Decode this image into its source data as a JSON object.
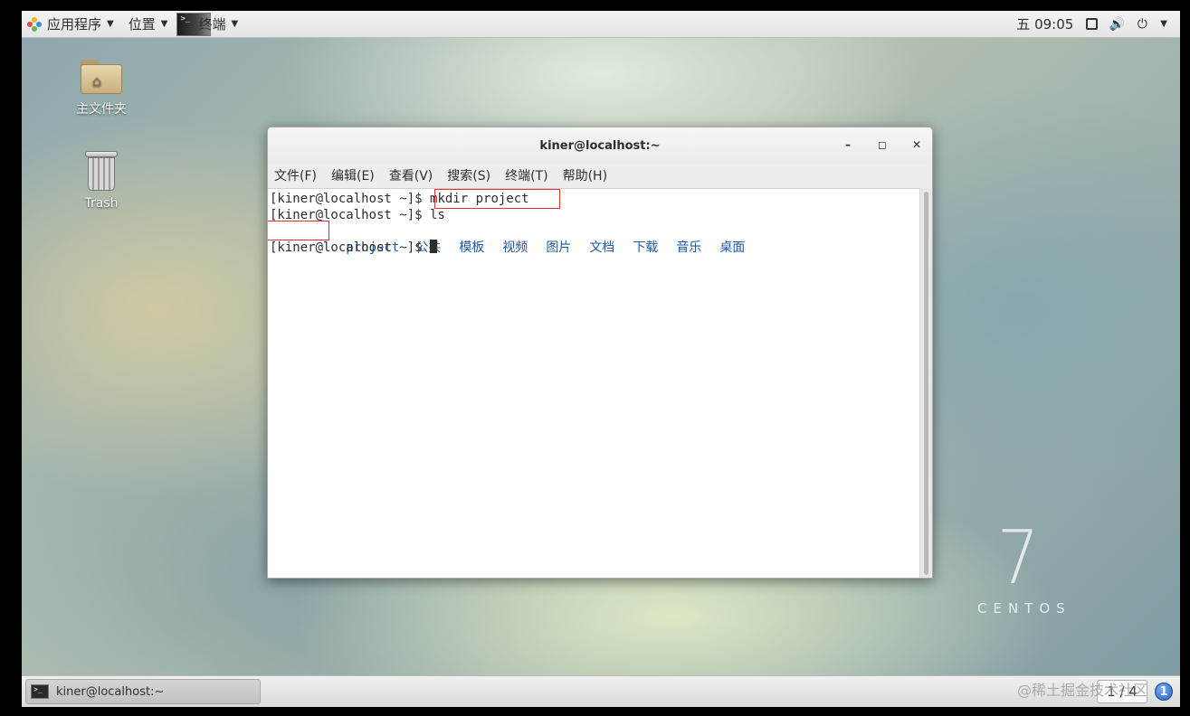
{
  "topbar": {
    "applications_label": "应用程序",
    "places_label": "位置",
    "terminal_label": "终端",
    "clock": "五 09:05"
  },
  "desktop": {
    "icons": [
      {
        "label": "主文件夹",
        "icon": "home-folder-icon"
      },
      {
        "label": "Trash",
        "icon": "trash-icon"
      }
    ],
    "branding": {
      "number": "7",
      "word": "CENTOS"
    }
  },
  "window": {
    "title": "kiner@localhost:~",
    "controls": {
      "minimize": "–",
      "maximize": "◻",
      "close": "✕"
    },
    "menu": [
      "文件(F)",
      "编辑(E)",
      "查看(V)",
      "搜索(S)",
      "终端(T)",
      "帮助(H)"
    ],
    "terminal": {
      "prompt": "[kiner@localhost ~]$ ",
      "commands": [
        "mkdir project",
        "ls"
      ],
      "ls_output": [
        "project",
        "公共",
        "模板",
        "视频",
        "图片",
        "文档",
        "下载",
        "音乐",
        "桌面"
      ]
    }
  },
  "taskbar": {
    "window_item": "kiner@localhost:~",
    "pager": "1 / 4",
    "info_glyph": "1"
  },
  "watermark": "@稀土掘金技术社区",
  "colors": {
    "ls_dir": "#1e5aa8",
    "highlight_box": "#e03030"
  }
}
